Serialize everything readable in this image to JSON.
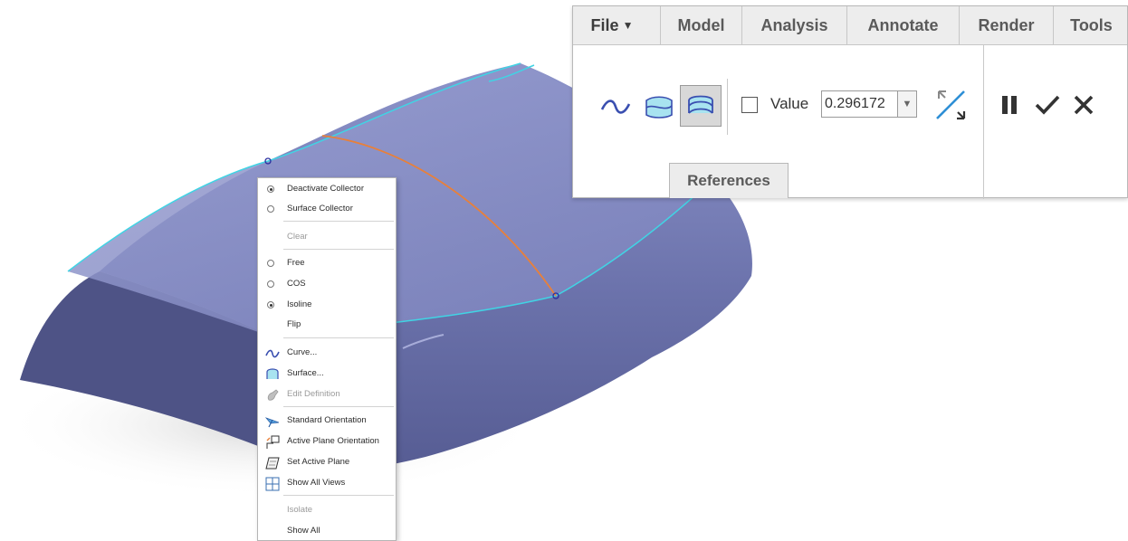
{
  "ribbon": {
    "tabs": [
      "File",
      "Model",
      "Analysis",
      "Annotate",
      "Render",
      "Tools"
    ],
    "value_label": "Value",
    "value": "0.296172",
    "references_label": "References",
    "icons": {
      "curve": "curve-icon",
      "surface": "surface-icon",
      "surface_isoline": "surface-isoline-icon",
      "flip": "flip-direction-icon",
      "pause": "pause-icon",
      "ok": "checkmark-icon",
      "cancel": "close-icon"
    }
  },
  "context_menu": {
    "items": [
      {
        "label": "Deactivate Collector",
        "type": "radio",
        "checked": true
      },
      {
        "label": "Surface Collector",
        "type": "radio",
        "checked": false
      },
      {
        "label": "Clear",
        "type": "item",
        "disabled": true
      },
      {
        "label": "Free",
        "type": "radio",
        "checked": false
      },
      {
        "label": "COS",
        "type": "radio",
        "checked": false
      },
      {
        "label": "Isoline",
        "type": "radio",
        "checked": true
      },
      {
        "label": "Flip",
        "type": "item"
      },
      {
        "label": "Curve...",
        "type": "icon",
        "icon": "curve-icon"
      },
      {
        "label": "Surface...",
        "type": "icon",
        "icon": "surface-icon"
      },
      {
        "label": "Edit Definition",
        "type": "icon",
        "icon": "edit-definition-icon",
        "disabled": true
      },
      {
        "label": "Standard Orientation",
        "type": "icon",
        "icon": "standard-orientation-icon"
      },
      {
        "label": "Active Plane Orientation",
        "type": "icon",
        "icon": "active-plane-orientation-icon"
      },
      {
        "label": "Set Active Plane",
        "type": "icon",
        "icon": "set-active-plane-icon"
      },
      {
        "label": "Show All Views",
        "type": "icon",
        "icon": "show-all-views-icon"
      },
      {
        "label": "Isolate",
        "type": "item",
        "disabled": true
      },
      {
        "label": "Show All",
        "type": "item"
      }
    ]
  },
  "colors": {
    "surface_body": "#7279b2",
    "surface_top": "#8a91c8",
    "surface_inside": "#4e5386",
    "edge_highlight": "#40d4e4",
    "curve_orange": "#e8803a",
    "shadow": "#e6e6e6"
  }
}
